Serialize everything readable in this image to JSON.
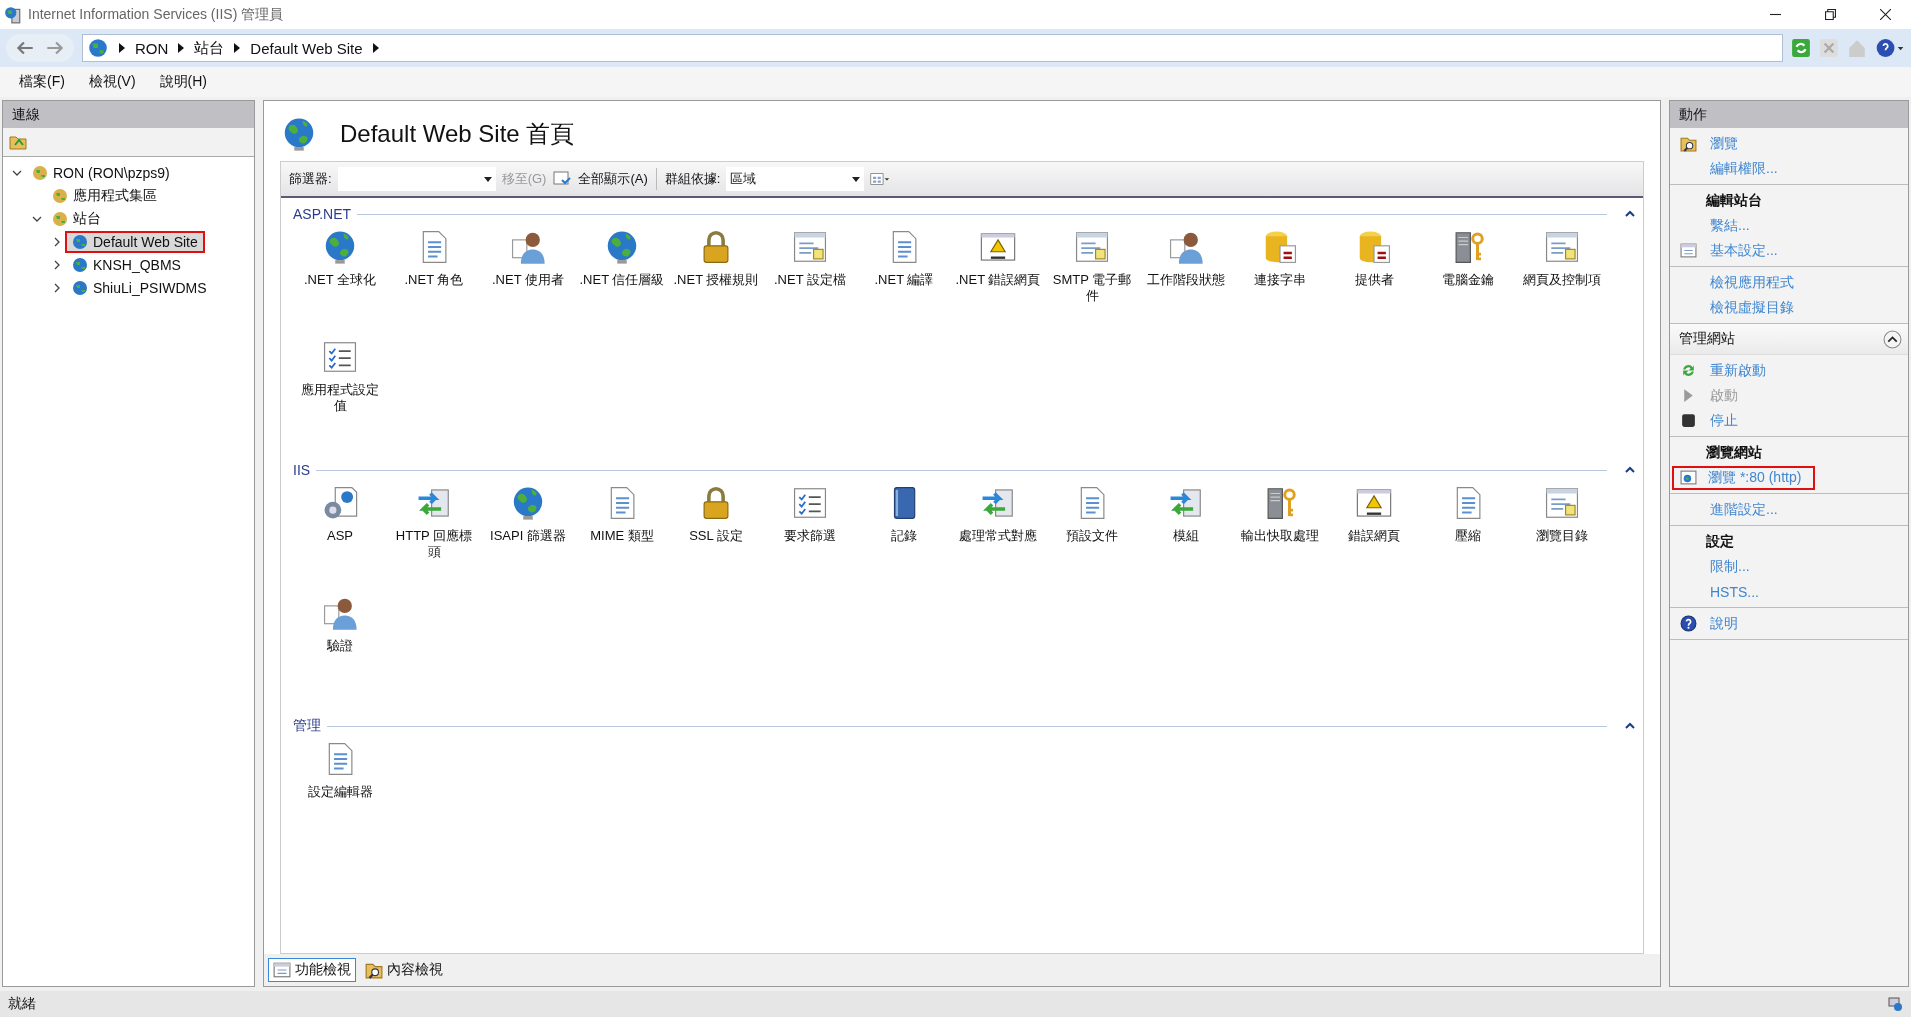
{
  "window": {
    "title": "Internet Information Services (IIS) 管理員"
  },
  "address_bar": {
    "crumbs": [
      "RON",
      "站台",
      "Default Web Site"
    ]
  },
  "menu": [
    "檔案(F)",
    "檢視(V)",
    "說明(H)"
  ],
  "connections": {
    "title": "連線",
    "tree": [
      {
        "label": "RON (RON\\pzps9)",
        "expanded": true,
        "selected": false,
        "highlighted": false,
        "children": [
          {
            "label": "應用程式集區",
            "selected": false,
            "highlighted": false
          },
          {
            "label": "站台",
            "expanded": true,
            "selected": false,
            "highlighted": false,
            "children": [
              {
                "label": "Default Web Site",
                "expanded": false,
                "selected": true,
                "highlighted": true
              },
              {
                "label": "KNSH_QBMS",
                "expanded": false,
                "selected": false,
                "highlighted": false
              },
              {
                "label": "ShiuLi_PSIWDMS",
                "expanded": false,
                "selected": false,
                "highlighted": false
              }
            ]
          }
        ]
      }
    ]
  },
  "home": {
    "title": "Default Web Site 首頁",
    "toolbar": {
      "filter_label": "篩選器:",
      "goto": {
        "label": "移至(G)",
        "disabled": true
      },
      "show_all": "全部顯示(A)",
      "group_label": "群組依據:",
      "group_value": "區域"
    },
    "sections": [
      {
        "title": "ASP.NET",
        "expanded": true,
        "items": [
          {
            "label": ".NET 全球化"
          },
          {
            "label": ".NET 角色"
          },
          {
            "label": ".NET 使用者"
          },
          {
            "label": ".NET 信任層級"
          },
          {
            "label": ".NET 授權規則"
          },
          {
            "label": ".NET 設定檔"
          },
          {
            "label": ".NET 編譯"
          },
          {
            "label": ".NET 錯誤網頁"
          },
          {
            "label": "SMTP 電子郵件"
          },
          {
            "label": "工作階段狀態"
          },
          {
            "label": "連接字串"
          },
          {
            "label": "提供者"
          },
          {
            "label": "電腦金鑰"
          },
          {
            "label": "網頁及控制項"
          },
          {
            "label": "應用程式設定值"
          }
        ]
      },
      {
        "title": "IIS",
        "expanded": true,
        "items": [
          {
            "label": "ASP"
          },
          {
            "label": "HTTP 回應標頭"
          },
          {
            "label": "ISAPI 篩選器"
          },
          {
            "label": "MIME 類型"
          },
          {
            "label": "SSL 設定"
          },
          {
            "label": "要求篩選"
          },
          {
            "label": "記錄"
          },
          {
            "label": "處理常式對應"
          },
          {
            "label": "預設文件"
          },
          {
            "label": "模組"
          },
          {
            "label": "輸出快取處理"
          },
          {
            "label": "錯誤網頁"
          },
          {
            "label": "壓縮"
          },
          {
            "label": "瀏覽目錄"
          },
          {
            "label": "驗證"
          }
        ]
      },
      {
        "title": "管理",
        "expanded": true,
        "items": [
          {
            "label": "設定編輯器"
          }
        ]
      }
    ]
  },
  "view_tabs": [
    {
      "label": "功能檢視",
      "selected": true
    },
    {
      "label": "內容檢視",
      "selected": false
    }
  ],
  "actions": {
    "title": "動作",
    "blocks": [
      {
        "kind": "group",
        "items": [
          {
            "label": "瀏覽",
            "disabled": false,
            "highlighted": false
          },
          {
            "label": "編輯權限...",
            "disabled": false,
            "highlighted": false
          }
        ]
      },
      {
        "kind": "group",
        "heading": "編輯站台",
        "items": [
          {
            "label": "繫結...",
            "disabled": false,
            "highlighted": false
          },
          {
            "label": "基本設定...",
            "disabled": false,
            "highlighted": false
          }
        ]
      },
      {
        "kind": "group",
        "items": [
          {
            "label": "檢視應用程式",
            "disabled": false,
            "highlighted": false
          },
          {
            "label": "檢視虛擬目錄",
            "disabled": false,
            "highlighted": false
          }
        ]
      },
      {
        "kind": "section",
        "title": "管理網站",
        "expanded": true
      },
      {
        "kind": "group",
        "items": [
          {
            "label": "重新啟動",
            "disabled": false,
            "highlighted": false
          },
          {
            "label": "啟動",
            "disabled": true,
            "highlighted": false
          },
          {
            "label": "停止",
            "disabled": false,
            "highlighted": false
          }
        ]
      },
      {
        "kind": "group",
        "heading": "瀏覽網站",
        "items": [
          {
            "label": "瀏覽 *:80 (http)",
            "disabled": false,
            "highlighted": true
          }
        ]
      },
      {
        "kind": "group",
        "items": [
          {
            "label": "進階設定...",
            "disabled": false,
            "highlighted": false
          }
        ]
      },
      {
        "kind": "group",
        "heading": "設定",
        "items": [
          {
            "label": "限制...",
            "disabled": false,
            "highlighted": false
          },
          {
            "label": "HSTS...",
            "disabled": false,
            "highlighted": false
          }
        ]
      },
      {
        "kind": "group",
        "items": [
          {
            "label": "說明",
            "disabled": false,
            "highlighted": false
          }
        ]
      }
    ]
  },
  "status_bar": {
    "text": "就緒"
  }
}
